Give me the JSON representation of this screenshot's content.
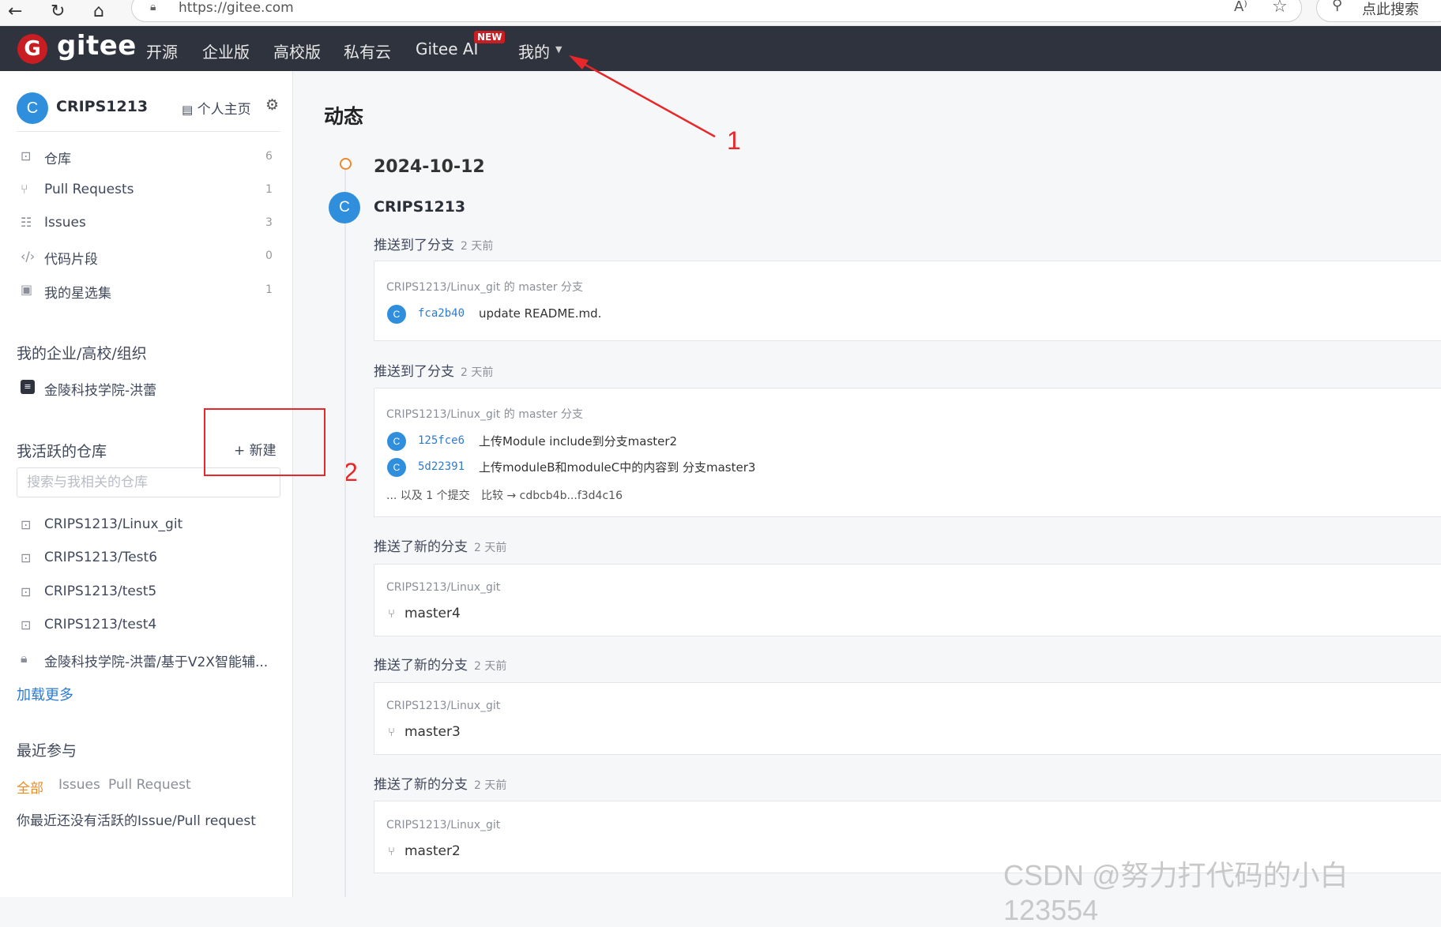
{
  "browser": {
    "url": "https://gitee.com",
    "search_placeholder": "点此搜索"
  },
  "navbar": {
    "logo_mark": "G",
    "logo_text": "gitee",
    "items": [
      "开源",
      "企业版",
      "高校版",
      "私有云",
      "Gitee AI",
      "我的"
    ],
    "new_badge": "NEW"
  },
  "sidebar": {
    "user_initial": "C",
    "user_name": "CRIPS1213",
    "profile_link": "个人主页",
    "menu": [
      {
        "label": "仓库",
        "count": "6",
        "icon": "repo-icon"
      },
      {
        "label": "Pull Requests",
        "count": "1",
        "icon": "pull-request-icon"
      },
      {
        "label": "Issues",
        "count": "3",
        "icon": "issues-icon"
      },
      {
        "label": "代码片段",
        "count": "0",
        "icon": "code-icon"
      },
      {
        "label": "我的星选集",
        "count": "1",
        "icon": "star-collection-icon"
      }
    ],
    "org_heading": "我的企业/高校/组织",
    "org_name": "金陵科技学院-洪蕾",
    "repos_heading": "我活跃的仓库",
    "new_button": "+ 新建",
    "repo_search_placeholder": "搜索与我相关的仓库",
    "repos": [
      "CRIPS1213/Linux_git",
      "CRIPS1213/Test6",
      "CRIPS1213/test5",
      "CRIPS1213/test4",
      "金陵科技学院-洪蕾/基于V2X智能辅..."
    ],
    "load_more": "加载更多",
    "recent_heading": "最近参与",
    "recent_tabs": [
      "全部",
      "Issues",
      "Pull Request"
    ],
    "no_activity": "你最近还没有活跃的Issue/Pull request"
  },
  "annotations": {
    "one": "1",
    "two": "2"
  },
  "feed": {
    "title": "动态",
    "date": "2024-10-12",
    "user_initial": "C",
    "user_name": "CRIPS1213",
    "events": [
      {
        "head": "推送到了分支",
        "time": "2 天前",
        "repo": "CRIPS1213/Linux_git 的 master 分支",
        "commits": [
          {
            "sha": "fca2b40",
            "msg": "update README.md."
          }
        ]
      },
      {
        "head": "推送到了分支",
        "time": "2 天前",
        "repo": "CRIPS1213/Linux_git 的 master 分支",
        "commits": [
          {
            "sha": "125fce6",
            "msg": "上传Module include到分支master2"
          },
          {
            "sha": "5d22391",
            "msg": "上传moduleB和moduleC中的内容到 分支master3"
          }
        ],
        "more": "... 以及 1 个提交",
        "compare": "比较 → cdbcb4b...f3d4c16"
      },
      {
        "head": "推送了新的分支",
        "time": "2 天前",
        "repo": "CRIPS1213/Linux_git",
        "branch": "master4"
      },
      {
        "head": "推送了新的分支",
        "time": "2 天前",
        "repo": "CRIPS1213/Linux_git",
        "branch": "master3"
      },
      {
        "head": "推送了新的分支",
        "time": "2 天前",
        "repo": "CRIPS1213/Linux_git",
        "branch": "master2"
      }
    ]
  },
  "watermark": "CSDN @努力打代码的小白123554"
}
